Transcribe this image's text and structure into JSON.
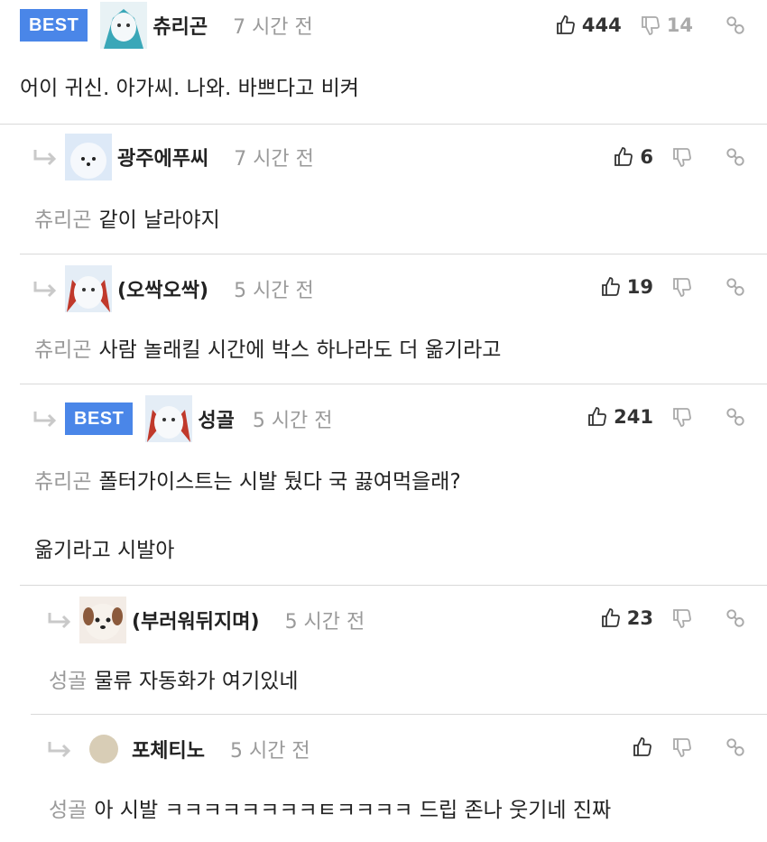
{
  "best_label": "BEST",
  "comments": [
    {
      "user": "츄리곤",
      "time": "7 시간 전",
      "likes": "444",
      "dislikes": "14",
      "mention": "",
      "lines": [
        "어이 귀신. 아가씨. 나와. 바쁘다고 비켜"
      ]
    },
    {
      "user": "광주에푸씨",
      "time": "7 시간 전",
      "likes": "6",
      "dislikes": "",
      "mention": "츄리곤",
      "lines": [
        "같이 날라야지"
      ]
    },
    {
      "user": "(오싹오싹)",
      "time": "5 시간 전",
      "likes": "19",
      "dislikes": "",
      "mention": "츄리곤",
      "lines": [
        "사람 놀래킬 시간에 박스 하나라도 더 옮기라고"
      ]
    },
    {
      "user": "성골",
      "time": "5 시간 전",
      "likes": "241",
      "dislikes": "",
      "mention": "츄리곤",
      "lines": [
        "폴터가이스트는 시발 뒀다 국 끓여먹을래?",
        "옮기라고 시발아"
      ]
    },
    {
      "user": "(부러워뒤지며)",
      "time": "5 시간 전",
      "likes": "23",
      "dislikes": "",
      "mention": "성골",
      "lines": [
        "물류 자동화가 여기있네"
      ]
    },
    {
      "user": "포체티노",
      "time": "5 시간 전",
      "likes": "",
      "dislikes": "",
      "mention": "성골",
      "lines": [
        "아 시발 ㅋㅋㅋㅋㅋㅋㅋㅋㅌㅋㅋㅋㅋ 드립 존나 웃기네 진짜"
      ]
    }
  ],
  "colors": {
    "best_badge": "#4a86e8",
    "mention": "#9a9a9a",
    "divider": "#d9d9d9"
  },
  "icons": [
    "reply-arrow-icon",
    "thumbs-up-icon",
    "thumbs-down-icon",
    "share-link-icon"
  ]
}
